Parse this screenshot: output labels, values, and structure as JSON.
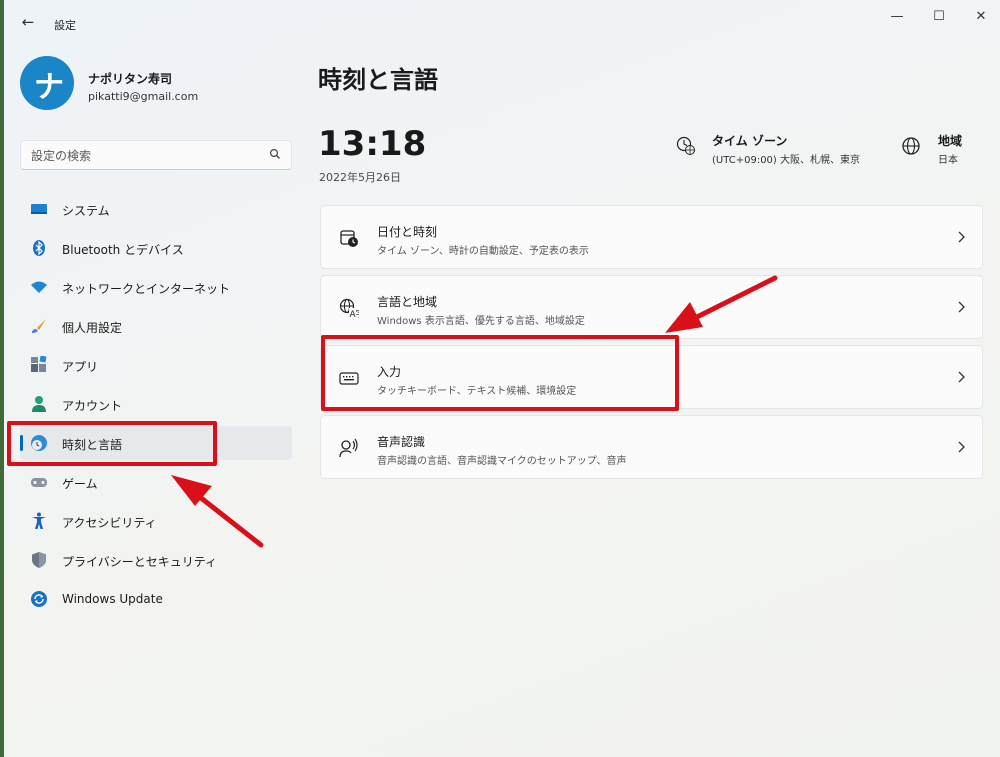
{
  "window": {
    "app_title": "設定",
    "controls": {
      "minimize": "—",
      "maximize": "☐",
      "close": "✕"
    },
    "back_glyph": "←"
  },
  "user": {
    "avatar_mark": "ナ",
    "name": "ナポリタン寿司",
    "email": "pikatti9@gmail.com"
  },
  "search": {
    "placeholder": "設定の検索"
  },
  "sidebar": {
    "items": [
      {
        "label": "システム",
        "icon": "system-icon"
      },
      {
        "label": "Bluetooth とデバイス",
        "icon": "bluetooth-icon"
      },
      {
        "label": "ネットワークとインターネット",
        "icon": "wifi-icon"
      },
      {
        "label": "個人用設定",
        "icon": "brush-icon"
      },
      {
        "label": "アプリ",
        "icon": "apps-icon"
      },
      {
        "label": "アカウント",
        "icon": "account-icon"
      },
      {
        "label": "時刻と言語",
        "icon": "time-language-icon",
        "selected": true
      },
      {
        "label": "ゲーム",
        "icon": "gamepad-icon"
      },
      {
        "label": "アクセシビリティ",
        "icon": "accessibility-icon"
      },
      {
        "label": "プライバシーとセキュリティ",
        "icon": "shield-icon"
      },
      {
        "label": "Windows Update",
        "icon": "windows-update-icon"
      }
    ]
  },
  "main": {
    "title": "時刻と言語",
    "clock": "13:18",
    "date": "2022年5月26日",
    "timezone": {
      "title": "タイム ゾーン",
      "value": "(UTC+09:00) 大阪、札幌、東京"
    },
    "region": {
      "title": "地域",
      "value": "日本"
    },
    "cards": [
      {
        "title": "日付と時刻",
        "subtitle": "タイム ゾーン、時計の自動設定、予定表の表示",
        "icon": "calendar-clock-icon"
      },
      {
        "title": "言語と地域",
        "subtitle": "Windows 表示言語、優先する言語、地域設定",
        "icon": "language-icon"
      },
      {
        "title": "入力",
        "subtitle": "タッチキーボード、テキスト候補、環境設定",
        "icon": "keyboard-icon"
      },
      {
        "title": "音声認識",
        "subtitle": "音声認識の言語、音声認識マイクのセットアップ、音声",
        "icon": "speech-icon"
      }
    ]
  },
  "colors": {
    "accent": "#0067c0",
    "annotation": "#d9101a",
    "avatar": "#1a86c7"
  }
}
